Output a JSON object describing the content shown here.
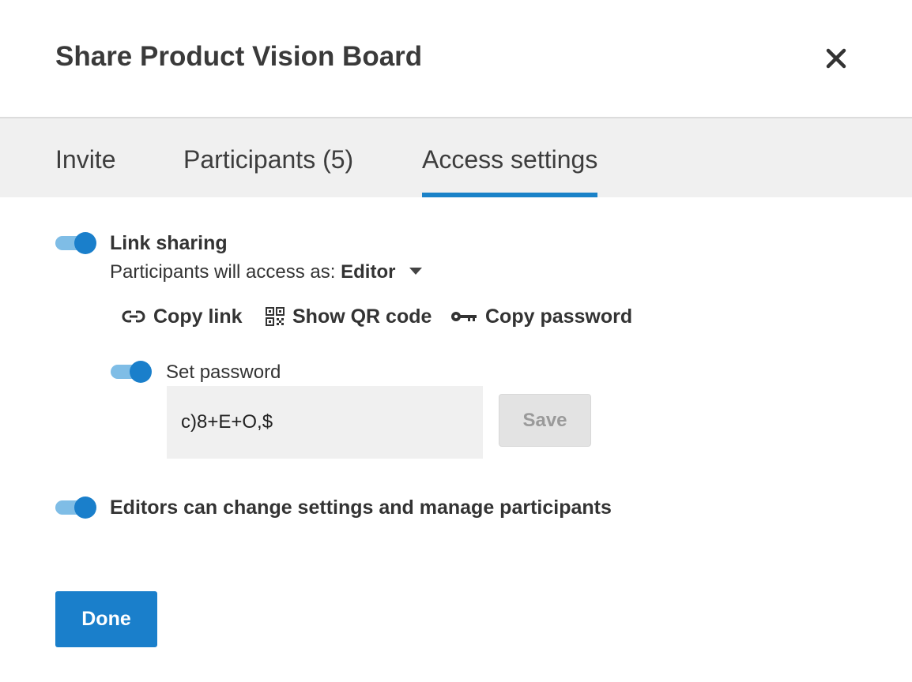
{
  "dialog": {
    "title": "Share Product Vision Board",
    "close_icon": "close-icon"
  },
  "tabs": [
    {
      "label": "Invite",
      "active": false
    },
    {
      "label": "Participants (5)",
      "active": false
    },
    {
      "label": "Access settings",
      "active": true
    }
  ],
  "link_sharing": {
    "enabled": true,
    "label": "Link sharing",
    "access_prefix": "Participants will access as:",
    "access_role": "Editor",
    "actions": {
      "copy_link": {
        "label": "Copy link",
        "icon": "link-icon"
      },
      "show_qr": {
        "label": "Show QR code",
        "icon": "qr-code-icon"
      },
      "copy_password": {
        "label": "Copy password",
        "icon": "key-icon"
      }
    }
  },
  "password": {
    "enabled": true,
    "label": "Set password",
    "value": "c)8+E+O,$",
    "save_label": "Save"
  },
  "editors_setting": {
    "enabled": true,
    "label": "Editors can change settings and manage participants"
  },
  "footer": {
    "done_label": "Done"
  },
  "colors": {
    "accent": "#1a7fcb",
    "toggle_track": "#7fbde6",
    "tab_bar": "#f0f0f0"
  }
}
